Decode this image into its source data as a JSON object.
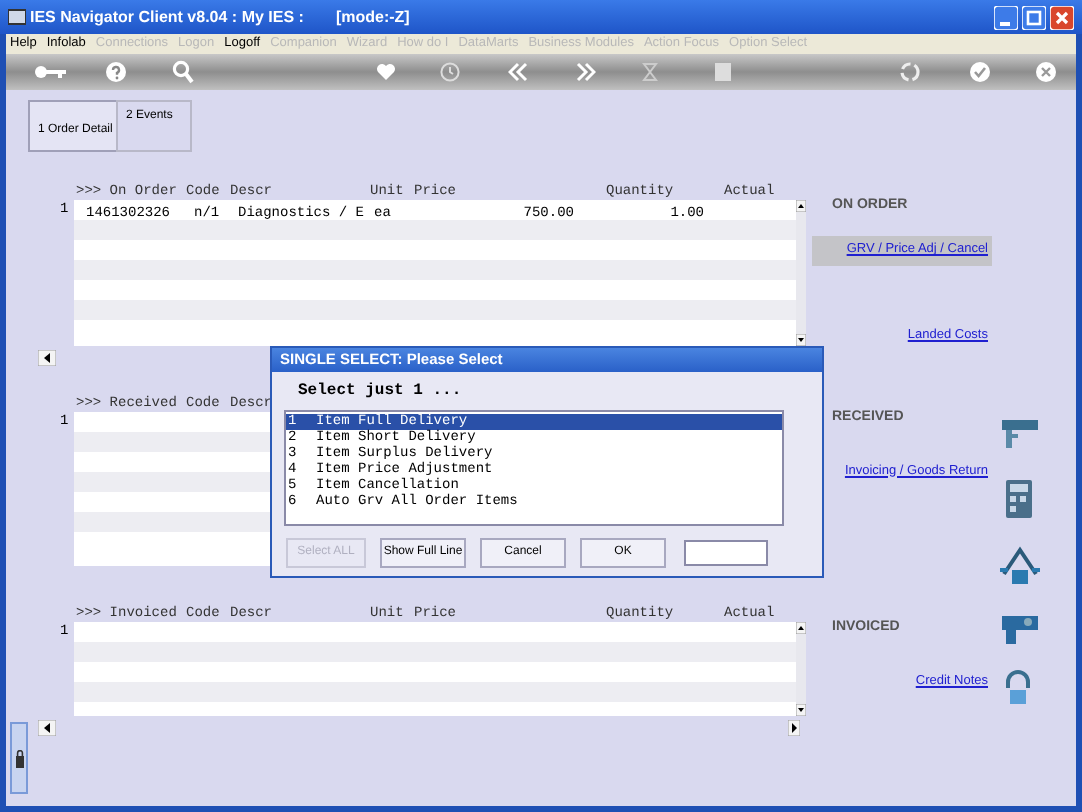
{
  "window": {
    "title": "IES Navigator Client v8.04 : My IES :",
    "mode": "[mode:-Z]"
  },
  "menu": [
    {
      "label": "Help",
      "disabled": false
    },
    {
      "label": "Infolab",
      "disabled": false
    },
    {
      "label": "Connections",
      "disabled": true
    },
    {
      "label": "Logon",
      "disabled": true
    },
    {
      "label": "Logoff",
      "disabled": false
    },
    {
      "label": "Companion",
      "disabled": true
    },
    {
      "label": "Wizard",
      "disabled": true
    },
    {
      "label": "How do I",
      "disabled": true
    },
    {
      "label": "DataMarts",
      "disabled": true
    },
    {
      "label": "Business Modules",
      "disabled": true
    },
    {
      "label": "Action Focus",
      "disabled": true
    },
    {
      "label": "Option Select",
      "disabled": true
    }
  ],
  "tabs": [
    {
      "label": "1 Order Detail",
      "selected": true
    },
    {
      "label": "2 Events",
      "selected": false
    }
  ],
  "panels": [
    {
      "columns": [
        ">>> On Order",
        "Code",
        "Descr",
        "Unit",
        "Price",
        "Quantity",
        "Actual"
      ],
      "rows": [
        {
          "number": "1",
          "cells": [
            "1461302326",
            "n/1",
            "Diagnostics / E",
            "ea",
            "750.00",
            "1.00",
            ""
          ]
        }
      ],
      "section": "ON ORDER",
      "links": [
        {
          "label": "GRV / Price Adj / Cancel",
          "selected": true
        },
        {
          "label": "Landed Costs",
          "selected": false
        }
      ],
      "scrollbars": true
    },
    {
      "columns": [
        ">>> Received",
        "Code",
        "Descr"
      ],
      "rows": [
        {
          "number": "1",
          "cells": []
        }
      ],
      "section": "RECEIVED",
      "links": [
        {
          "label": "Invoicing / Goods Return",
          "selected": false
        }
      ]
    },
    {
      "columns": [
        ">>> Invoiced",
        "Code",
        "Descr",
        "Unit",
        "Price",
        "Quantity",
        "Actual"
      ],
      "rows": [
        {
          "number": "1",
          "cells": []
        }
      ],
      "section": "INVOICED",
      "links": [
        {
          "label": "Credit Notes",
          "selected": false
        }
      ],
      "scrollbars": true
    }
  ],
  "dialog": {
    "title": "SINGLE SELECT: Please Select",
    "prompt": "Select just 1 ...",
    "items": [
      {
        "number": "1",
        "label": "Item Full Delivery",
        "selected": true
      },
      {
        "number": "2",
        "label": "Item Short Delivery",
        "selected": false
      },
      {
        "number": "3",
        "label": "Item Surplus Delivery",
        "selected": false
      },
      {
        "number": "4",
        "label": "Item Price Adjustment",
        "selected": false
      },
      {
        "number": "5",
        "label": "Item Cancellation",
        "selected": false
      },
      {
        "number": "6",
        "label": "Auto Grv All Order Items",
        "selected": false
      }
    ],
    "buttons": [
      {
        "label": "Select ALL",
        "disabled": true
      },
      {
        "label": "Show Full Line",
        "disabled": false
      },
      {
        "label": "Cancel",
        "disabled": false
      },
      {
        "label": "OK",
        "disabled": false
      }
    ]
  }
}
